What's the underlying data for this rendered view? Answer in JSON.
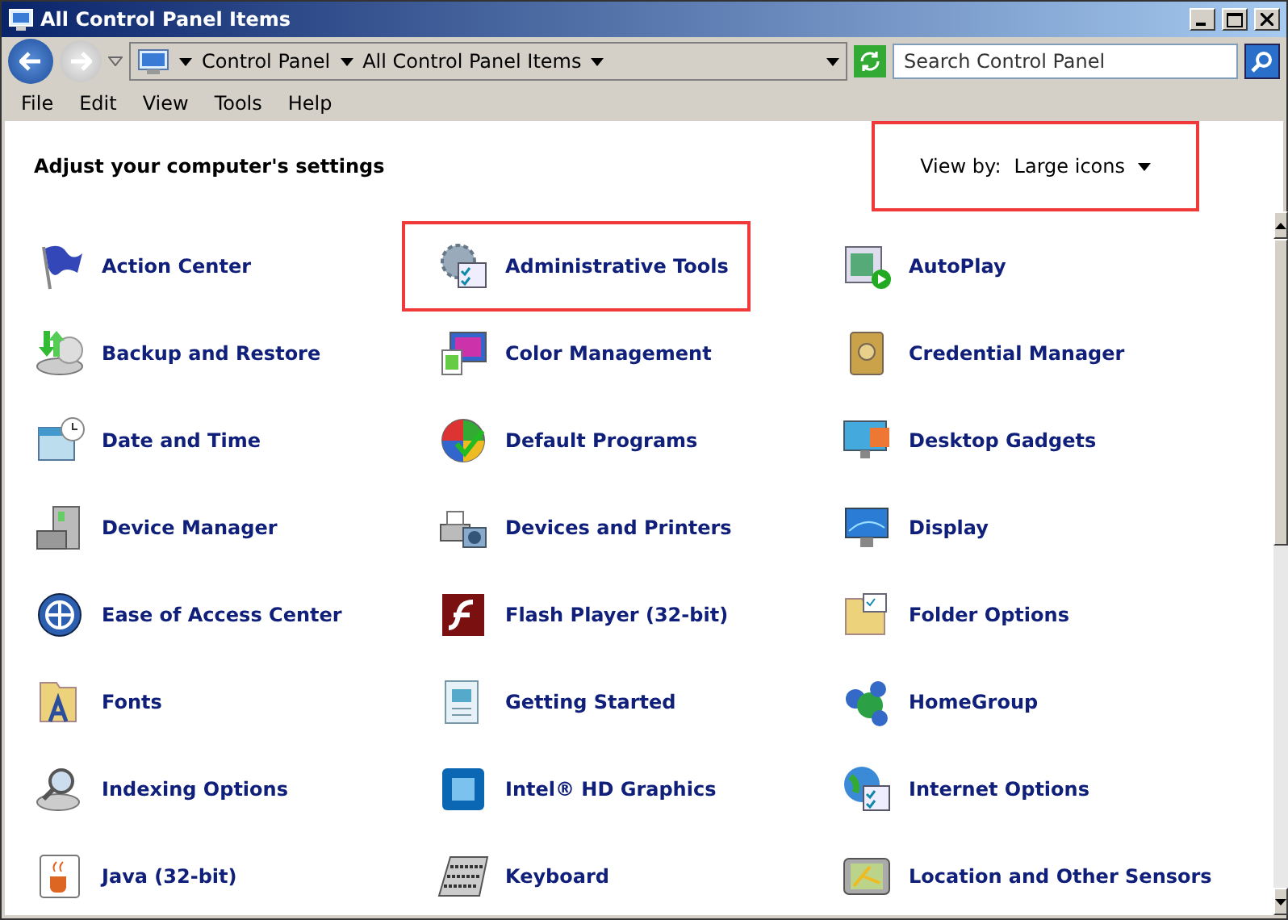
{
  "window": {
    "title": "All Control Panel Items"
  },
  "address_bar": {
    "breadcrumbs": [
      "Control Panel",
      "All Control Panel Items"
    ]
  },
  "search": {
    "placeholder": "Search Control Panel"
  },
  "menu": [
    "File",
    "Edit",
    "View",
    "Tools",
    "Help"
  ],
  "heading": "Adjust your computer's settings",
  "view_by": {
    "label": "View by:",
    "value": "Large icons",
    "highlighted": true
  },
  "items": [
    {
      "label": "Action Center",
      "highlighted": false
    },
    {
      "label": "Administrative Tools",
      "highlighted": true
    },
    {
      "label": "AutoPlay",
      "highlighted": false
    },
    {
      "label": "Backup and Restore",
      "highlighted": false
    },
    {
      "label": "Color Management",
      "highlighted": false
    },
    {
      "label": "Credential Manager",
      "highlighted": false
    },
    {
      "label": "Date and Time",
      "highlighted": false
    },
    {
      "label": "Default Programs",
      "highlighted": false
    },
    {
      "label": "Desktop Gadgets",
      "highlighted": false
    },
    {
      "label": "Device Manager",
      "highlighted": false
    },
    {
      "label": "Devices and Printers",
      "highlighted": false
    },
    {
      "label": "Display",
      "highlighted": false
    },
    {
      "label": "Ease of Access Center",
      "highlighted": false
    },
    {
      "label": "Flash Player (32-bit)",
      "highlighted": false
    },
    {
      "label": "Folder Options",
      "highlighted": false
    },
    {
      "label": "Fonts",
      "highlighted": false
    },
    {
      "label": "Getting Started",
      "highlighted": false
    },
    {
      "label": "HomeGroup",
      "highlighted": false
    },
    {
      "label": "Indexing Options",
      "highlighted": false
    },
    {
      "label": "Intel® HD Graphics",
      "highlighted": false
    },
    {
      "label": "Internet Options",
      "highlighted": false
    },
    {
      "label": "Java (32-bit)",
      "highlighted": false
    },
    {
      "label": "Keyboard",
      "highlighted": false
    },
    {
      "label": "Location and Other Sensors",
      "highlighted": false
    }
  ]
}
